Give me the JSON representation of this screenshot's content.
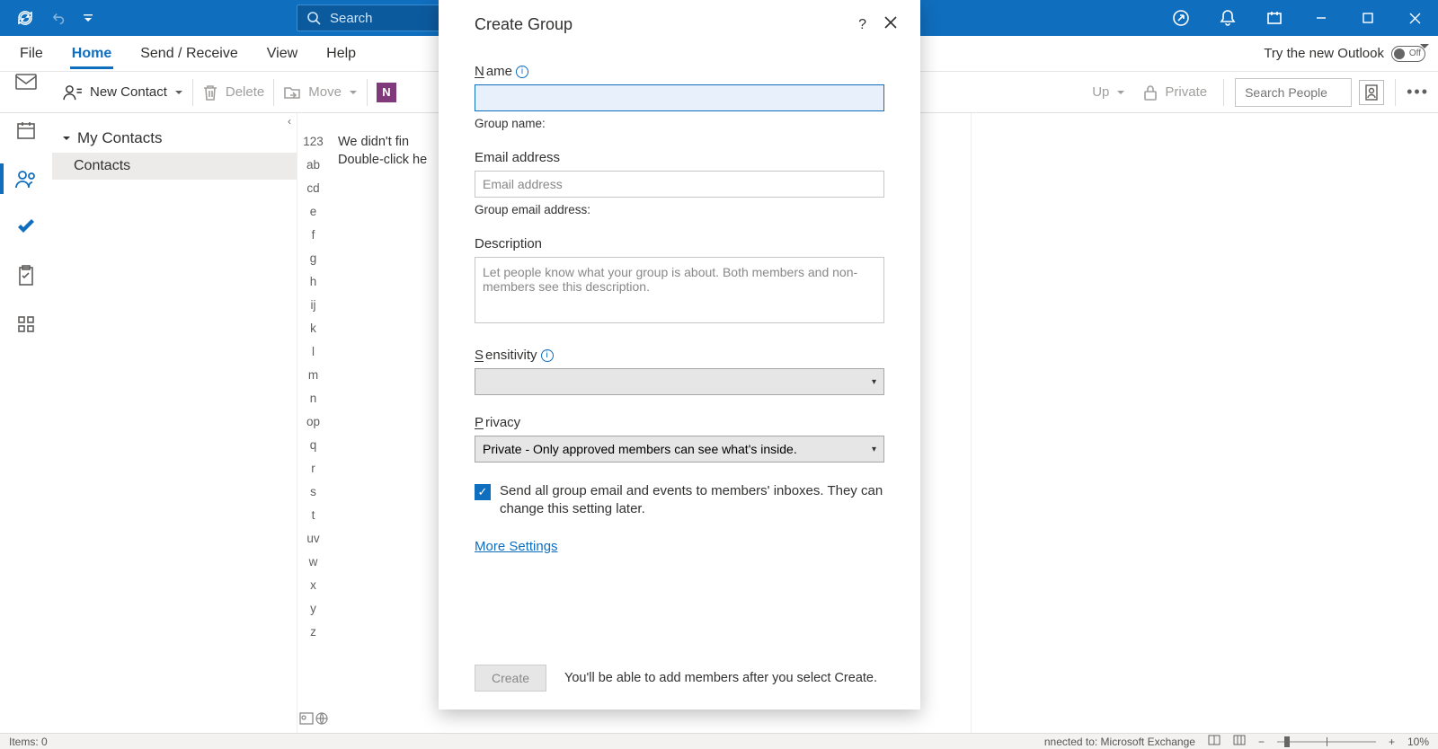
{
  "titlebar": {
    "search_placeholder": "Search"
  },
  "menubar": {
    "items": [
      "File",
      "Home",
      "Send / Receive",
      "View",
      "Help"
    ],
    "active": "Home",
    "try_new": "Try the new Outlook",
    "toggle_state": "Off"
  },
  "ribbon": {
    "new_contact": "New Contact",
    "delete": "Delete",
    "move": "Move",
    "followup_tail": "Up",
    "private": "Private",
    "search_people_placeholder": "Search People"
  },
  "folderpane": {
    "group": "My Contacts",
    "folder": "Contacts"
  },
  "index_letters": [
    "123",
    "ab",
    "cd",
    "e",
    "f",
    "g",
    "h",
    "ij",
    "k",
    "l",
    "m",
    "n",
    "op",
    "q",
    "r",
    "s",
    "t",
    "uv",
    "w",
    "x",
    "y",
    "z"
  ],
  "listarea": {
    "line1": "We didn't fin",
    "line2": "Double-click he"
  },
  "dialog": {
    "title": "Create Group",
    "name_label_prefix": "N",
    "name_label_rest": "ame",
    "group_name_sub": "Group name:",
    "email_label": "Email address",
    "email_placeholder": "Email address",
    "email_sub": "Group email address:",
    "desc_label": "Description",
    "desc_placeholder": "Let people know what your group is about. Both members and non-members see this description.",
    "sensitivity_prefix": "S",
    "sensitivity_rest": "ensitivity",
    "privacy_prefix": "P",
    "privacy_rest": "rivacy",
    "privacy_value": "Private - Only approved members can see what's inside.",
    "check_text": "Send all group email and events to members' inboxes. They can change this setting later.",
    "more_settings": "More Settings",
    "create_btn": "Create",
    "foot_text": "You'll be able to add members after you select Create."
  },
  "statusbar": {
    "items": "Items: 0",
    "connected": "nnected to: Microsoft Exchange",
    "zoom": "10%"
  }
}
